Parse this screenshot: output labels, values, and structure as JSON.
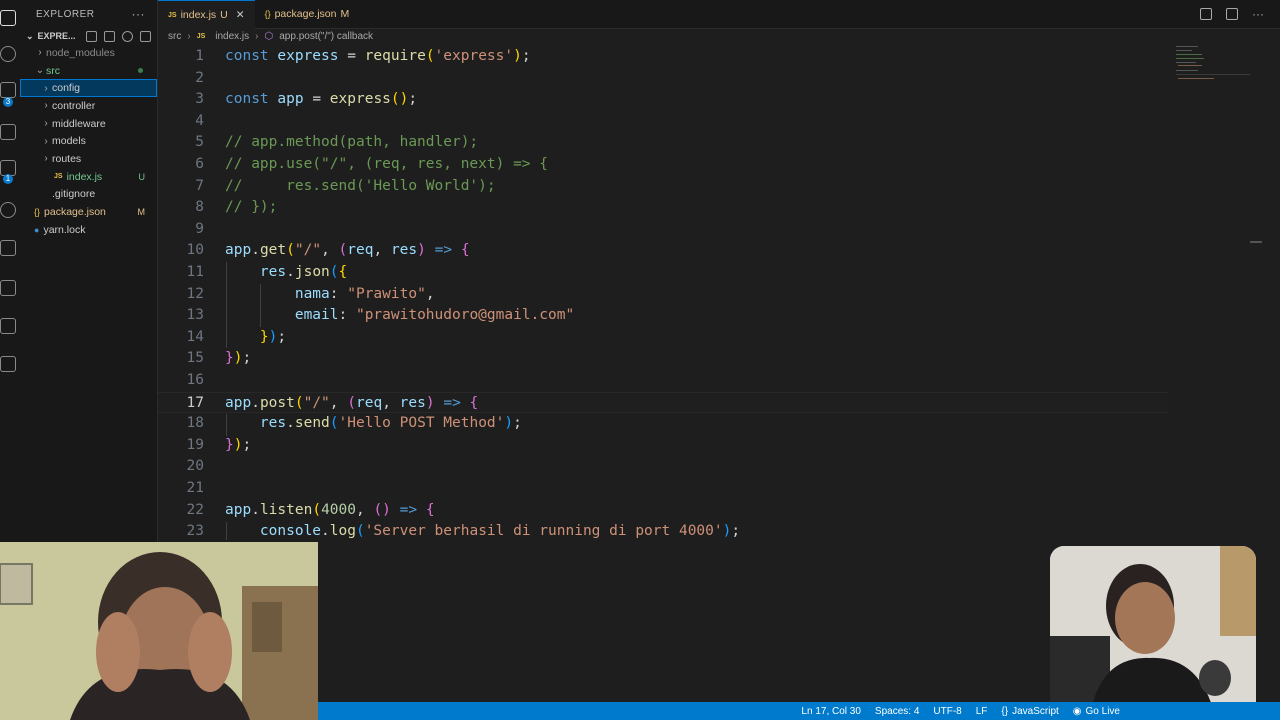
{
  "sidebar": {
    "title": "EXPLORER",
    "project": "EXPRE...",
    "items": [
      {
        "label": "node_modules",
        "kind": "folder",
        "depth": 1,
        "expanded": false,
        "status": "",
        "color": "#8b8b8b"
      },
      {
        "label": "src",
        "kind": "folder",
        "depth": 1,
        "expanded": true,
        "status": "",
        "color": "#73c991"
      },
      {
        "label": "config",
        "kind": "folder",
        "depth": 2,
        "expanded": false,
        "status": "",
        "color": "#cccccc",
        "selected": true
      },
      {
        "label": "controller",
        "kind": "folder",
        "depth": 2,
        "expanded": false,
        "status": "",
        "color": "#cccccc"
      },
      {
        "label": "middleware",
        "kind": "folder",
        "depth": 2,
        "expanded": false,
        "status": "",
        "color": "#cccccc"
      },
      {
        "label": "models",
        "kind": "folder",
        "depth": 2,
        "expanded": false,
        "status": "",
        "color": "#cccccc"
      },
      {
        "label": "routes",
        "kind": "folder",
        "depth": 2,
        "expanded": false,
        "status": "",
        "color": "#cccccc"
      },
      {
        "label": "index.js",
        "kind": "js",
        "depth": 2,
        "status": "U",
        "color": "#73c991"
      },
      {
        "label": ".gitignore",
        "kind": "git",
        "depth": 1,
        "status": "",
        "color": "#cccccc"
      },
      {
        "label": "package.json",
        "kind": "json",
        "depth": 1,
        "status": "M",
        "color": "#e2c08d"
      },
      {
        "label": "yarn.lock",
        "kind": "yarn",
        "depth": 1,
        "status": "",
        "color": "#cccccc"
      }
    ]
  },
  "tabs": [
    {
      "icon": "JS",
      "label": "index.js",
      "status": "U",
      "active": true
    },
    {
      "icon": "{}",
      "label": "package.json",
      "status": "M",
      "active": false
    }
  ],
  "breadcrumb": [
    "src",
    "index.js",
    "app.post(\"/\") callback"
  ],
  "editor": {
    "current_line": 17,
    "lines": [
      {
        "n": "1",
        "t": [
          [
            "kw",
            "const"
          ],
          [
            "pl",
            " "
          ],
          [
            "var",
            "express"
          ],
          [
            "pl",
            " = "
          ],
          [
            "fn",
            "require"
          ],
          [
            "b1",
            "("
          ],
          [
            "str",
            "'express'"
          ],
          [
            "b1",
            ")"
          ],
          [
            "pl",
            ";"
          ]
        ]
      },
      {
        "n": "2",
        "t": []
      },
      {
        "n": "3",
        "t": [
          [
            "kw",
            "const"
          ],
          [
            "pl",
            " "
          ],
          [
            "var",
            "app"
          ],
          [
            "pl",
            " = "
          ],
          [
            "fn",
            "express"
          ],
          [
            "b1",
            "()"
          ],
          [
            "pl",
            ";"
          ]
        ]
      },
      {
        "n": "4",
        "t": []
      },
      {
        "n": "5",
        "t": [
          [
            "cm",
            "// app.method(path, handler);"
          ]
        ]
      },
      {
        "n": "6",
        "t": [
          [
            "cm",
            "// app.use(\"/\", (req, res, next) => {"
          ]
        ]
      },
      {
        "n": "7",
        "t": [
          [
            "cm",
            "//     res.send('Hello World');"
          ]
        ]
      },
      {
        "n": "8",
        "t": [
          [
            "cm",
            "// });"
          ]
        ]
      },
      {
        "n": "9",
        "t": []
      },
      {
        "n": "10",
        "t": [
          [
            "var",
            "app"
          ],
          [
            "pl",
            "."
          ],
          [
            "fn",
            "get"
          ],
          [
            "b1",
            "("
          ],
          [
            "str",
            "\"/\""
          ],
          [
            "pl",
            ", "
          ],
          [
            "b2",
            "("
          ],
          [
            "var",
            "req"
          ],
          [
            "pl",
            ", "
          ],
          [
            "var",
            "res"
          ],
          [
            "b2",
            ")"
          ],
          [
            "pl",
            " "
          ],
          [
            "kw",
            "=>"
          ],
          [
            "pl",
            " "
          ],
          [
            "b2",
            "{"
          ]
        ]
      },
      {
        "n": "11",
        "t": [
          [
            "pl",
            "    "
          ],
          [
            "var",
            "res"
          ],
          [
            "pl",
            "."
          ],
          [
            "fn",
            "json"
          ],
          [
            "b3",
            "("
          ],
          [
            "b1",
            "{"
          ]
        ]
      },
      {
        "n": "12",
        "t": [
          [
            "pl",
            "        "
          ],
          [
            "prop",
            "nama"
          ],
          [
            "pl",
            ": "
          ],
          [
            "str",
            "\"Prawito\""
          ],
          [
            "pl",
            ","
          ]
        ]
      },
      {
        "n": "13",
        "t": [
          [
            "pl",
            "        "
          ],
          [
            "prop",
            "email"
          ],
          [
            "pl",
            ": "
          ],
          [
            "str",
            "\"prawitohudoro@gmail.com\""
          ]
        ]
      },
      {
        "n": "14",
        "t": [
          [
            "pl",
            "    "
          ],
          [
            "b1",
            "}"
          ],
          [
            "b3",
            ")"
          ],
          [
            "pl",
            ";"
          ]
        ]
      },
      {
        "n": "15",
        "t": [
          [
            "b2",
            "}"
          ],
          [
            "b1",
            ")"
          ],
          [
            "pl",
            ";"
          ]
        ]
      },
      {
        "n": "16",
        "t": []
      },
      {
        "n": "17",
        "t": [
          [
            "var",
            "app"
          ],
          [
            "pl",
            "."
          ],
          [
            "fn",
            "post"
          ],
          [
            "b1",
            "("
          ],
          [
            "str",
            "\"/\""
          ],
          [
            "pl",
            ", "
          ],
          [
            "b2",
            "("
          ],
          [
            "var",
            "req"
          ],
          [
            "pl",
            ", "
          ],
          [
            "var",
            "res"
          ],
          [
            "b2",
            ")"
          ],
          [
            "pl",
            " "
          ],
          [
            "kw",
            "=>"
          ],
          [
            "pl",
            " "
          ],
          [
            "b2",
            "{"
          ]
        ]
      },
      {
        "n": "18",
        "t": [
          [
            "pl",
            "    "
          ],
          [
            "var",
            "res"
          ],
          [
            "pl",
            "."
          ],
          [
            "fn",
            "send"
          ],
          [
            "b3",
            "("
          ],
          [
            "str",
            "'Hello POST Method'"
          ],
          [
            "b3",
            ")"
          ],
          [
            "pl",
            ";"
          ]
        ]
      },
      {
        "n": "19",
        "t": [
          [
            "b2",
            "}"
          ],
          [
            "b1",
            ")"
          ],
          [
            "pl",
            ";"
          ]
        ]
      },
      {
        "n": "20",
        "t": []
      },
      {
        "n": "21",
        "t": []
      },
      {
        "n": "22",
        "t": [
          [
            "var",
            "app"
          ],
          [
            "pl",
            "."
          ],
          [
            "fn",
            "listen"
          ],
          [
            "b1",
            "("
          ],
          [
            "num",
            "4000"
          ],
          [
            "pl",
            ", "
          ],
          [
            "b2",
            "()"
          ],
          [
            "pl",
            " "
          ],
          [
            "kw",
            "=>"
          ],
          [
            "pl",
            " "
          ],
          [
            "b2",
            "{"
          ]
        ]
      },
      {
        "n": "23",
        "t": [
          [
            "pl",
            "    "
          ],
          [
            "var",
            "console"
          ],
          [
            "pl",
            "."
          ],
          [
            "fn",
            "log"
          ],
          [
            "b3",
            "("
          ],
          [
            "str",
            "'Server berhasil di running di port 4000'"
          ],
          [
            "b3",
            ")"
          ],
          [
            "pl",
            ";"
          ]
        ]
      }
    ]
  },
  "status_bar": {
    "position": "Ln 17, Col 30",
    "spaces": "Spaces: 4",
    "encoding": "UTF-8",
    "eol": "LF",
    "language": "JavaScript",
    "golive": "Go Live"
  },
  "activity": {
    "scm_badge": "3",
    "ext_badge": "1"
  },
  "colors": {
    "accent": "#007acc",
    "selection": "#04395e",
    "untracked": "#73c991",
    "modified": "#e2c08d"
  }
}
